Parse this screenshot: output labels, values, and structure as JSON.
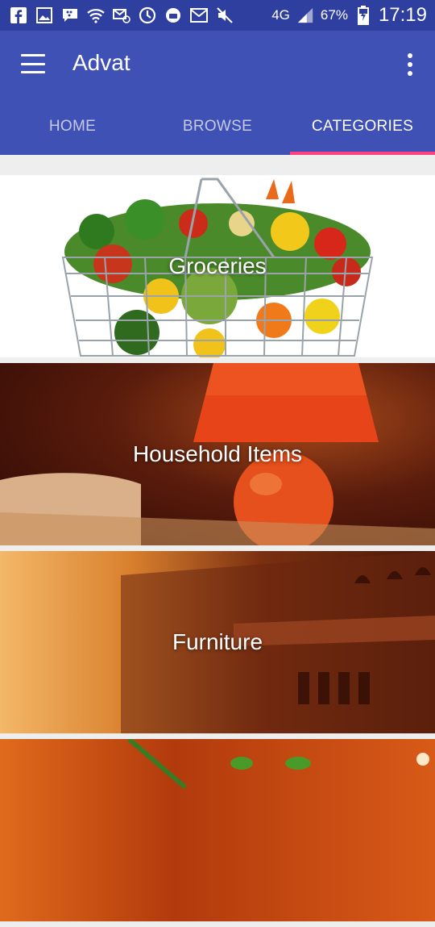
{
  "status_bar": {
    "battery": "67%",
    "network": "4G",
    "time": "17:19",
    "icons": [
      "facebook-icon",
      "gallery-icon",
      "bbm-icon",
      "wifi-icon",
      "mail-sync-icon",
      "sync-icon",
      "chat-icon",
      "gmail-icon",
      "mute-icon",
      "signal-icon",
      "battery-charging-icon"
    ]
  },
  "app_bar": {
    "title": "Advat",
    "menu_icon": "hamburger-menu-icon",
    "overflow_icon": "more-vert-icon"
  },
  "tabs": [
    {
      "label": "HOME"
    },
    {
      "label": "BROWSE"
    },
    {
      "label": "CATEGORIES"
    }
  ],
  "active_tab": "CATEGORIES",
  "colors": {
    "primary": "#3f51b5",
    "status": "#2f3f9f",
    "accent": "#ff4081"
  },
  "categories": [
    {
      "label": "Groceries"
    },
    {
      "label": "Household Items"
    },
    {
      "label": "Furniture"
    },
    {
      "label": ""
    }
  ]
}
